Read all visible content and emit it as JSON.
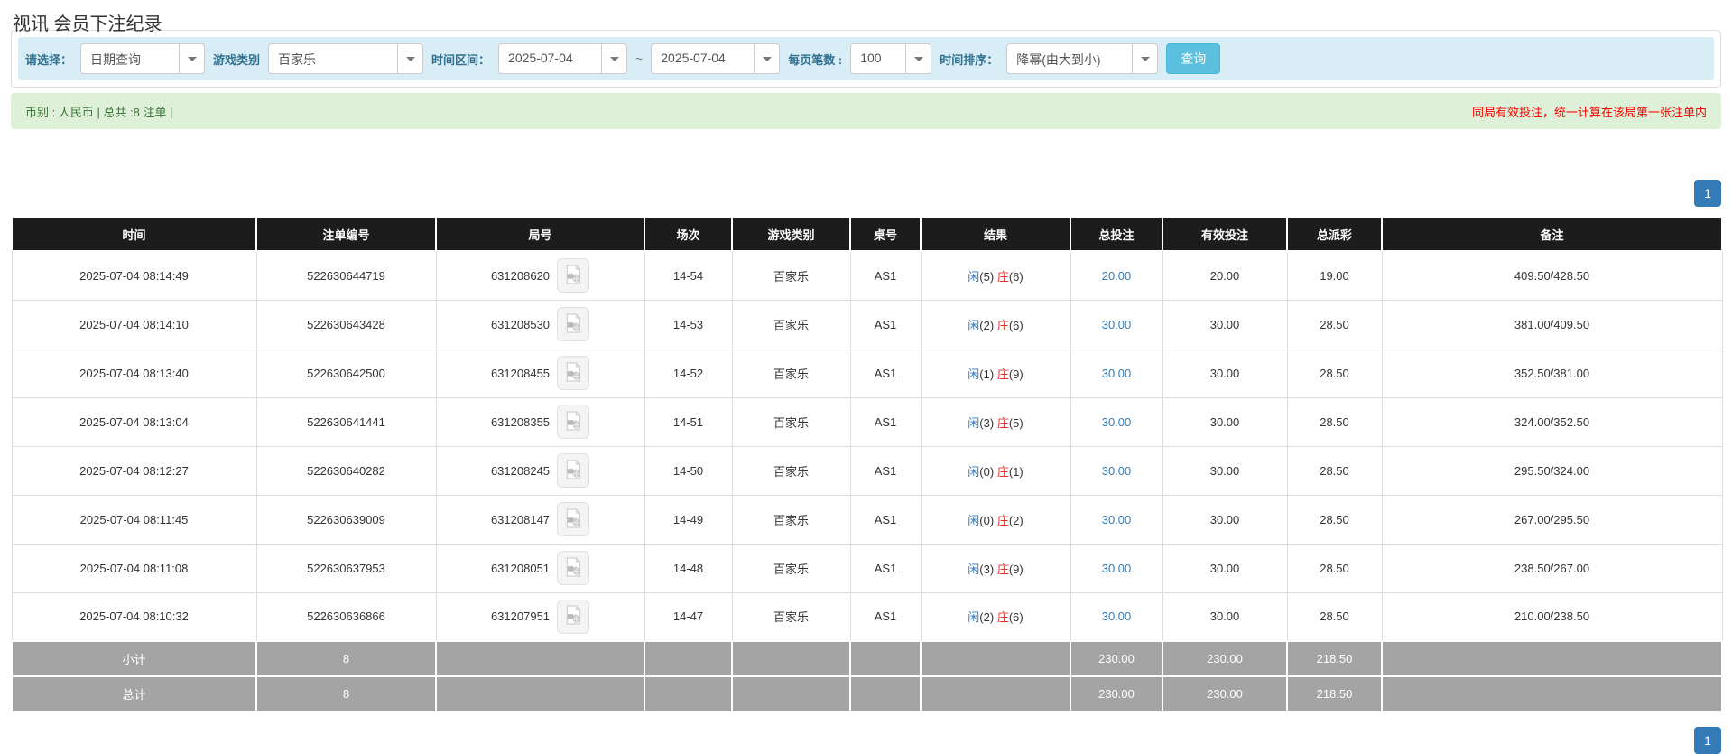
{
  "page_title": "视讯 会员下注纪录",
  "filters": {
    "query_type_label": "请选择：",
    "query_type_value": "日期查询",
    "game_category_label": "游戏类别",
    "game_category_value": "百家乐",
    "time_range_label": "时间区间：",
    "date_from": "2025-07-04",
    "range_separator": "~",
    "date_to": "2025-07-04",
    "page_size_label": "每页笔数 :",
    "page_size_value": "100",
    "sort_label": "时间排序：",
    "sort_value": "降幂(由大到小)",
    "search_button": "查询"
  },
  "summary": {
    "left_text": "币别 : 人民币 | 总共 :8 注单 |",
    "right_notice": "同局有效投注，统一计算在该局第一张注单内"
  },
  "pagination": {
    "page": "1"
  },
  "table": {
    "headers": [
      "时间",
      "注单编号",
      "局号",
      "场次",
      "游戏类别",
      "桌号",
      "结果",
      "总投注",
      "有效投注",
      "总派彩",
      "备注"
    ],
    "rows": [
      {
        "time": "2025-07-04 08:14:49",
        "bet_id": "522630644719",
        "round_id": "631208620",
        "session": "14-54",
        "game": "百家乐",
        "table_no": "AS1",
        "result": {
          "player": "闲",
          "player_score": "(5)",
          "banker": "庄",
          "banker_score": "(6)"
        },
        "total_bet": "20.00",
        "valid_bet": "20.00",
        "payout": "19.00",
        "remark": "409.50/428.50"
      },
      {
        "time": "2025-07-04 08:14:10",
        "bet_id": "522630643428",
        "round_id": "631208530",
        "session": "14-53",
        "game": "百家乐",
        "table_no": "AS1",
        "result": {
          "player": "闲",
          "player_score": "(2)",
          "banker": "庄",
          "banker_score": "(6)"
        },
        "total_bet": "30.00",
        "valid_bet": "30.00",
        "payout": "28.50",
        "remark": "381.00/409.50"
      },
      {
        "time": "2025-07-04 08:13:40",
        "bet_id": "522630642500",
        "round_id": "631208455",
        "session": "14-52",
        "game": "百家乐",
        "table_no": "AS1",
        "result": {
          "player": "闲",
          "player_score": "(1)",
          "banker": "庄",
          "banker_score": "(9)"
        },
        "total_bet": "30.00",
        "valid_bet": "30.00",
        "payout": "28.50",
        "remark": "352.50/381.00"
      },
      {
        "time": "2025-07-04 08:13:04",
        "bet_id": "522630641441",
        "round_id": "631208355",
        "session": "14-51",
        "game": "百家乐",
        "table_no": "AS1",
        "result": {
          "player": "闲",
          "player_score": "(3)",
          "banker": "庄",
          "banker_score": "(5)"
        },
        "total_bet": "30.00",
        "valid_bet": "30.00",
        "payout": "28.50",
        "remark": "324.00/352.50"
      },
      {
        "time": "2025-07-04 08:12:27",
        "bet_id": "522630640282",
        "round_id": "631208245",
        "session": "14-50",
        "game": "百家乐",
        "table_no": "AS1",
        "result": {
          "player": "闲",
          "player_score": "(0)",
          "banker": "庄",
          "banker_score": "(1)"
        },
        "total_bet": "30.00",
        "valid_bet": "30.00",
        "payout": "28.50",
        "remark": "295.50/324.00"
      },
      {
        "time": "2025-07-04 08:11:45",
        "bet_id": "522630639009",
        "round_id": "631208147",
        "session": "14-49",
        "game": "百家乐",
        "table_no": "AS1",
        "result": {
          "player": "闲",
          "player_score": "(0)",
          "banker": "庄",
          "banker_score": "(2)"
        },
        "total_bet": "30.00",
        "valid_bet": "30.00",
        "payout": "28.50",
        "remark": "267.00/295.50"
      },
      {
        "time": "2025-07-04 08:11:08",
        "bet_id": "522630637953",
        "round_id": "631208051",
        "session": "14-48",
        "game": "百家乐",
        "table_no": "AS1",
        "result": {
          "player": "闲",
          "player_score": "(3)",
          "banker": "庄",
          "banker_score": "(9)"
        },
        "total_bet": "30.00",
        "valid_bet": "30.00",
        "payout": "28.50",
        "remark": "238.50/267.00"
      },
      {
        "time": "2025-07-04 08:10:32",
        "bet_id": "522630636866",
        "round_id": "631207951",
        "session": "14-47",
        "game": "百家乐",
        "table_no": "AS1",
        "result": {
          "player": "闲",
          "player_score": "(2)",
          "banker": "庄",
          "banker_score": "(6)"
        },
        "total_bet": "30.00",
        "valid_bet": "30.00",
        "payout": "28.50",
        "remark": "210.00/238.50"
      }
    ],
    "subtotal": {
      "label": "小计",
      "count": "8",
      "total_bet": "230.00",
      "valid_bet": "230.00",
      "payout": "218.50"
    },
    "total": {
      "label": "总计",
      "count": "8",
      "total_bet": "230.00",
      "valid_bet": "230.00",
      "payout": "218.50"
    }
  },
  "icons": {
    "dropdown": "chevron-down-icon",
    "round_video": "video-replay-icon"
  },
  "colors": {
    "table_header_bg": "#1c1c1c",
    "filter_bar_bg": "#d9edf7",
    "filter_label": "#31708f",
    "summary_bg": "#dff0d8",
    "summary_text": "#3c763d",
    "notice_red": "#ff0000",
    "search_button_bg": "#5bc0de",
    "pagination_bg": "#337ab7",
    "player_blue": "#337ab7",
    "banker_red": "#e53333",
    "bet_link_blue": "#337ab7",
    "subtotal_bg": "#a4a4a4"
  }
}
